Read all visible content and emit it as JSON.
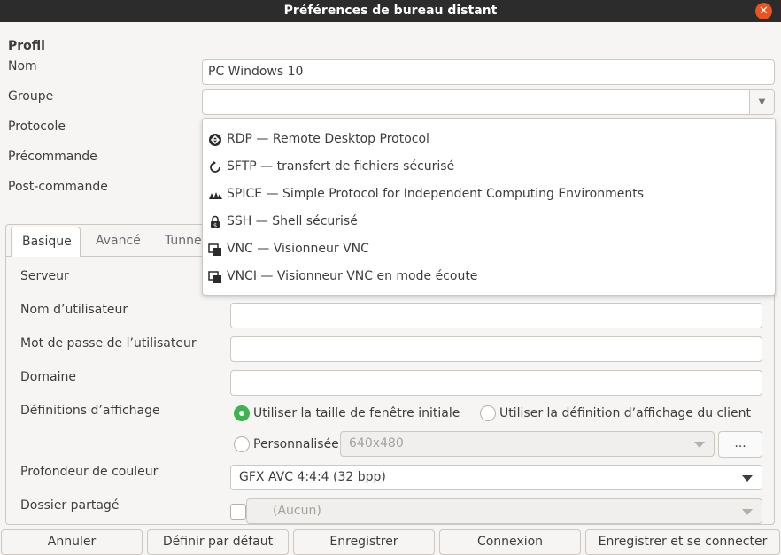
{
  "window": {
    "title": "Préférences de bureau distant"
  },
  "profile": {
    "heading": "Profil",
    "name_label": "Nom",
    "name_value": "PC Windows 10",
    "group_label": "Groupe",
    "group_value": "",
    "protocol_label": "Protocole",
    "precommand_label": "Précommande",
    "postcommand_label": "Post-commande"
  },
  "protocol_menu": {
    "items": [
      {
        "label": "RDP — Remote Desktop Protocol",
        "icon": "rdp-icon"
      },
      {
        "label": "SFTP — transfert de fichiers sécurisé",
        "icon": "sftp-icon"
      },
      {
        "label": "SPICE — Simple Protocol for Independent Computing Environments",
        "icon": "spice-icon"
      },
      {
        "label": "SSH — Shell sécurisé",
        "icon": "ssh-icon"
      },
      {
        "label": "VNC — Visionneur VNC",
        "icon": "vnc-icon"
      },
      {
        "label": "VNCI — Visionneur VNC en mode écoute",
        "icon": "vnci-icon"
      }
    ]
  },
  "tabs": [
    {
      "label": "Basique",
      "active": true
    },
    {
      "label": "Avancé",
      "active": false
    },
    {
      "label": "Tunne",
      "active": false
    }
  ],
  "basic": {
    "server_label": "Serveur",
    "username_label": "Nom d’utilisateur",
    "username_value": "",
    "password_label": "Mot de passe de l’utilisateur",
    "password_value": "",
    "domain_label": "Domaine",
    "domain_value": "",
    "resolution_label": "Définitions d’affichage",
    "resolution_initial": "Utiliser la taille de fenêtre initiale",
    "resolution_client": "Utiliser la définition d’affichage du client",
    "resolution_custom": "Personnalisée",
    "resolution_custom_value": "640x480",
    "resolution_more": "...",
    "color_depth_label": "Profondeur de couleur",
    "color_depth_value": "GFX AVC 4:4:4 (32 bpp)",
    "shared_folder_label": "Dossier partagé",
    "shared_folder_value": "(Aucun)"
  },
  "buttons": {
    "cancel": "Annuler",
    "default": "Définir par défaut",
    "save": "Enregistrer",
    "connect": "Connexion",
    "save_connect": "Enregistrer et se connecter"
  },
  "colors": {
    "accent_radio": "#3eb34f",
    "close_button": "#e95420",
    "titlebar": "#2c2c2c"
  }
}
